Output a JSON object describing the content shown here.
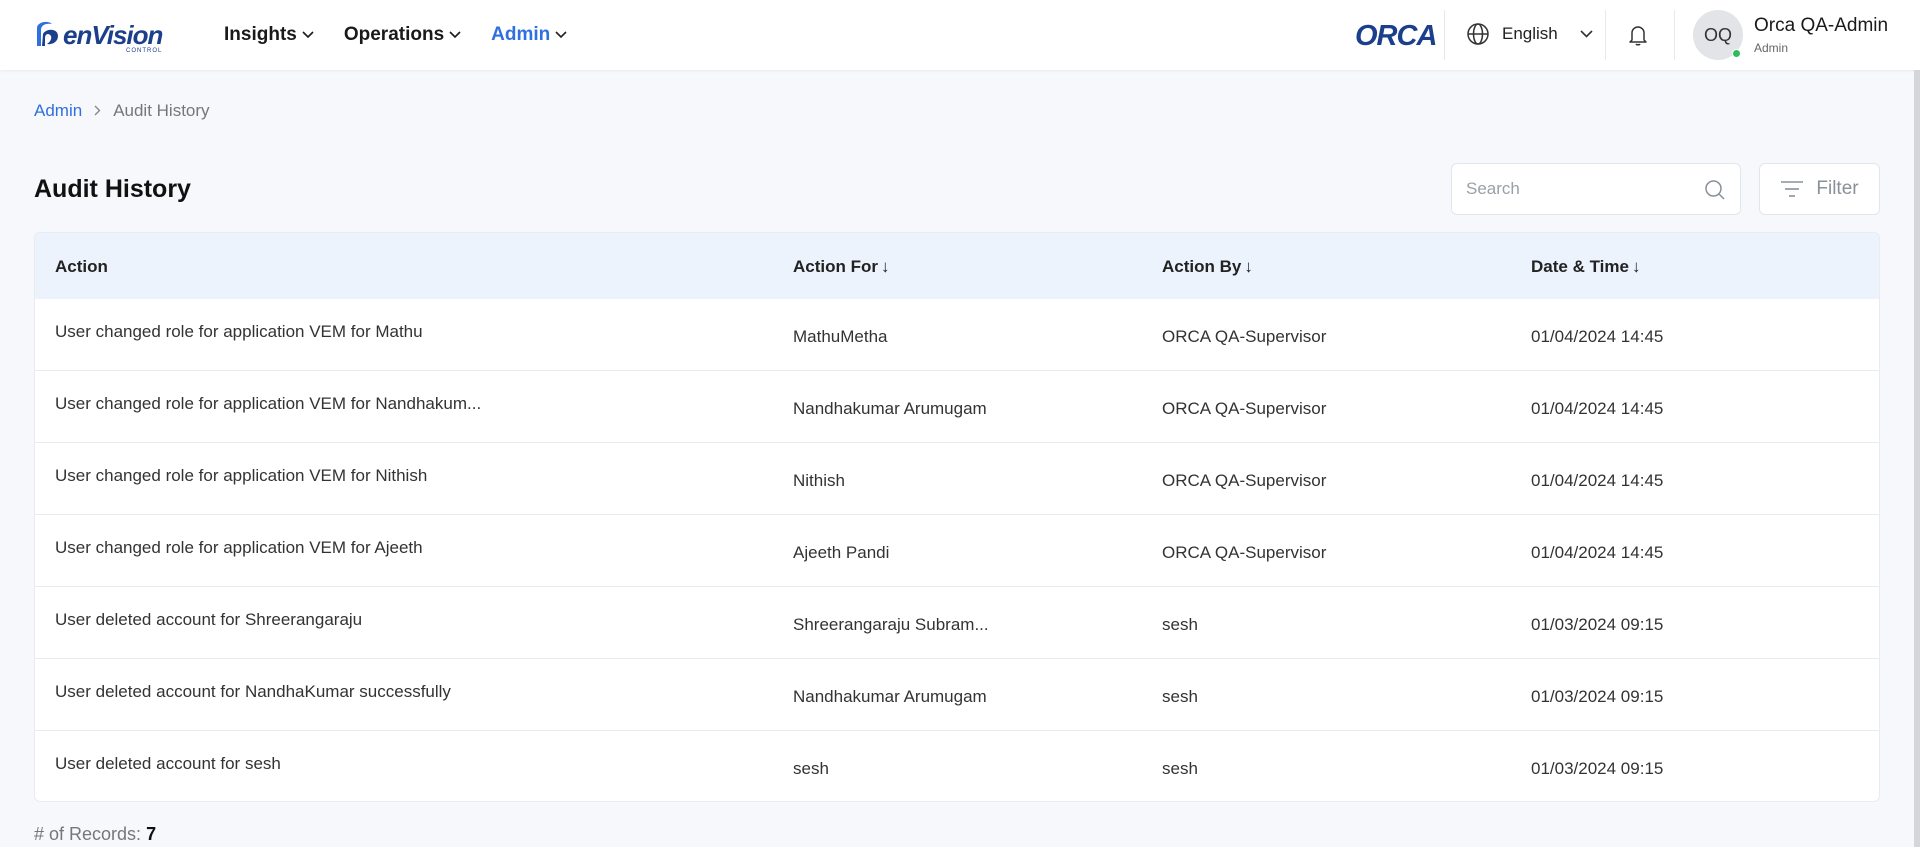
{
  "header": {
    "logo_word": "enVision",
    "logo_sub": "CONTROL",
    "nav": [
      {
        "label": "Insights"
      },
      {
        "label": "Operations"
      },
      {
        "label": "Admin"
      }
    ],
    "brand": "ORCA",
    "language": "English",
    "user": {
      "initials": "OQ",
      "name": "Orca QA-Admin",
      "role": "Admin"
    }
  },
  "breadcrumb": {
    "parent": "Admin",
    "current": "Audit History"
  },
  "page": {
    "title": "Audit History"
  },
  "search": {
    "placeholder": "Search",
    "value": ""
  },
  "filter": {
    "label": "Filter"
  },
  "table": {
    "headers": [
      {
        "label": "Action",
        "arrow": ""
      },
      {
        "label": "Action For",
        "arrow": "↓"
      },
      {
        "label": "Action By",
        "arrow": "↓"
      },
      {
        "label": "Date & Time",
        "arrow": "↓"
      }
    ],
    "rows": [
      {
        "action": "User changed role for application VEM for Mathu",
        "for": "MathuMetha",
        "by": "ORCA QA-Supervisor",
        "date": "01/04/2024 14:45"
      },
      {
        "action": "User changed role for application VEM for Nandhakum...",
        "for": "Nandhakumar Arumugam",
        "by": "ORCA QA-Supervisor",
        "date": "01/04/2024 14:45"
      },
      {
        "action": "User changed role for application VEM for Nithish",
        "for": "Nithish",
        "by": "ORCA QA-Supervisor",
        "date": "01/04/2024 14:45"
      },
      {
        "action": "User changed role for application VEM for Ajeeth",
        "for": "Ajeeth Pandi",
        "by": "ORCA QA-Supervisor",
        "date": "01/04/2024 14:45"
      },
      {
        "action": "User deleted account for Shreerangaraju",
        "for": "Shreerangaraju Subram...",
        "by": "sesh",
        "date": "01/03/2024 09:15"
      },
      {
        "action": "User deleted account for NandhaKumar successfully",
        "for": "Nandhakumar Arumugam",
        "by": "sesh",
        "date": "01/03/2024 09:15"
      },
      {
        "action": "User deleted account for sesh",
        "for": "sesh",
        "by": "sesh",
        "date": "01/03/2024 09:15"
      }
    ]
  },
  "records": {
    "label": "# of Records:",
    "count": "7"
  },
  "colors": {
    "accent": "#2f6fe0",
    "brand": "#1c3f8c",
    "header_bg": "#ecf3fd",
    "online": "#2ebc5a"
  }
}
